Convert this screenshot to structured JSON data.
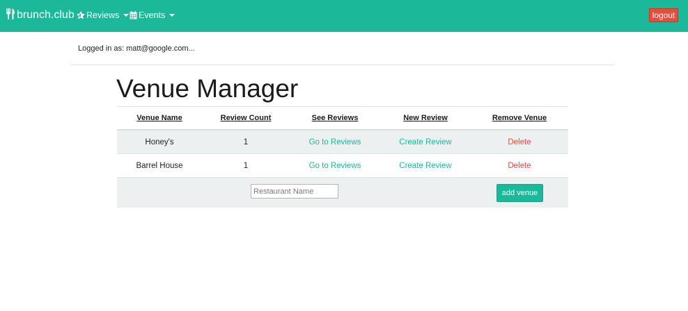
{
  "navbar": {
    "brand": "brunch.club",
    "brand_icon": "utensils-icon",
    "reviews_label": "Reviews",
    "reviews_icon": "star-icon",
    "events_label": "Events",
    "events_icon": "calendar-icon",
    "logout_label": "logout",
    "bg_color": "#1bb89a",
    "logout_color": "#e74c3c"
  },
  "user": {
    "logged_in_text": "Logged in as: matt@google.com..."
  },
  "page": {
    "title": "Venue Manager"
  },
  "table": {
    "headers": [
      "Venue Name",
      "Review Count",
      "See Reviews",
      "New Review",
      "Remove Venue"
    ],
    "rows": [
      {
        "venue": "Honey's",
        "count": "1",
        "see": "Go to Reviews",
        "new": "Create Review",
        "remove": "Delete"
      },
      {
        "venue": "Barrel House",
        "count": "1",
        "see": "Go to Reviews",
        "new": "Create Review",
        "remove": "Delete"
      }
    ]
  },
  "add_form": {
    "placeholder": "Restaurant Name",
    "value": "",
    "button_label": "add venue"
  }
}
